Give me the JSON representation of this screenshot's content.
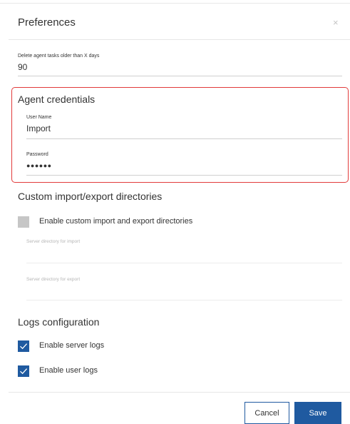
{
  "dialog": {
    "title": "Preferences",
    "close_glyph": "×"
  },
  "general": {
    "delete_tasks_label": "Delete agent tasks older than X days",
    "delete_tasks_value": "90"
  },
  "credentials": {
    "title": "Agent credentials",
    "username_label": "User Name",
    "username_value": "Import",
    "password_label": "Password",
    "password_value": "●●●●●●"
  },
  "directories": {
    "title": "Custom import/export directories",
    "enable_label": "Enable custom import and export directories",
    "enable_checked": false,
    "import_label": "Server directory for import",
    "export_label": "Server directory for export"
  },
  "logs": {
    "title": "Logs configuration",
    "server_logs_label": "Enable server logs",
    "server_logs_checked": true,
    "user_logs_label": "Enable user logs",
    "user_logs_checked": true
  },
  "footer": {
    "cancel_label": "Cancel",
    "save_label": "Save"
  },
  "colors": {
    "primary": "#1f5aa0",
    "highlight": "#e23b3b",
    "checkbox_unchecked": "#c6c6c6"
  }
}
